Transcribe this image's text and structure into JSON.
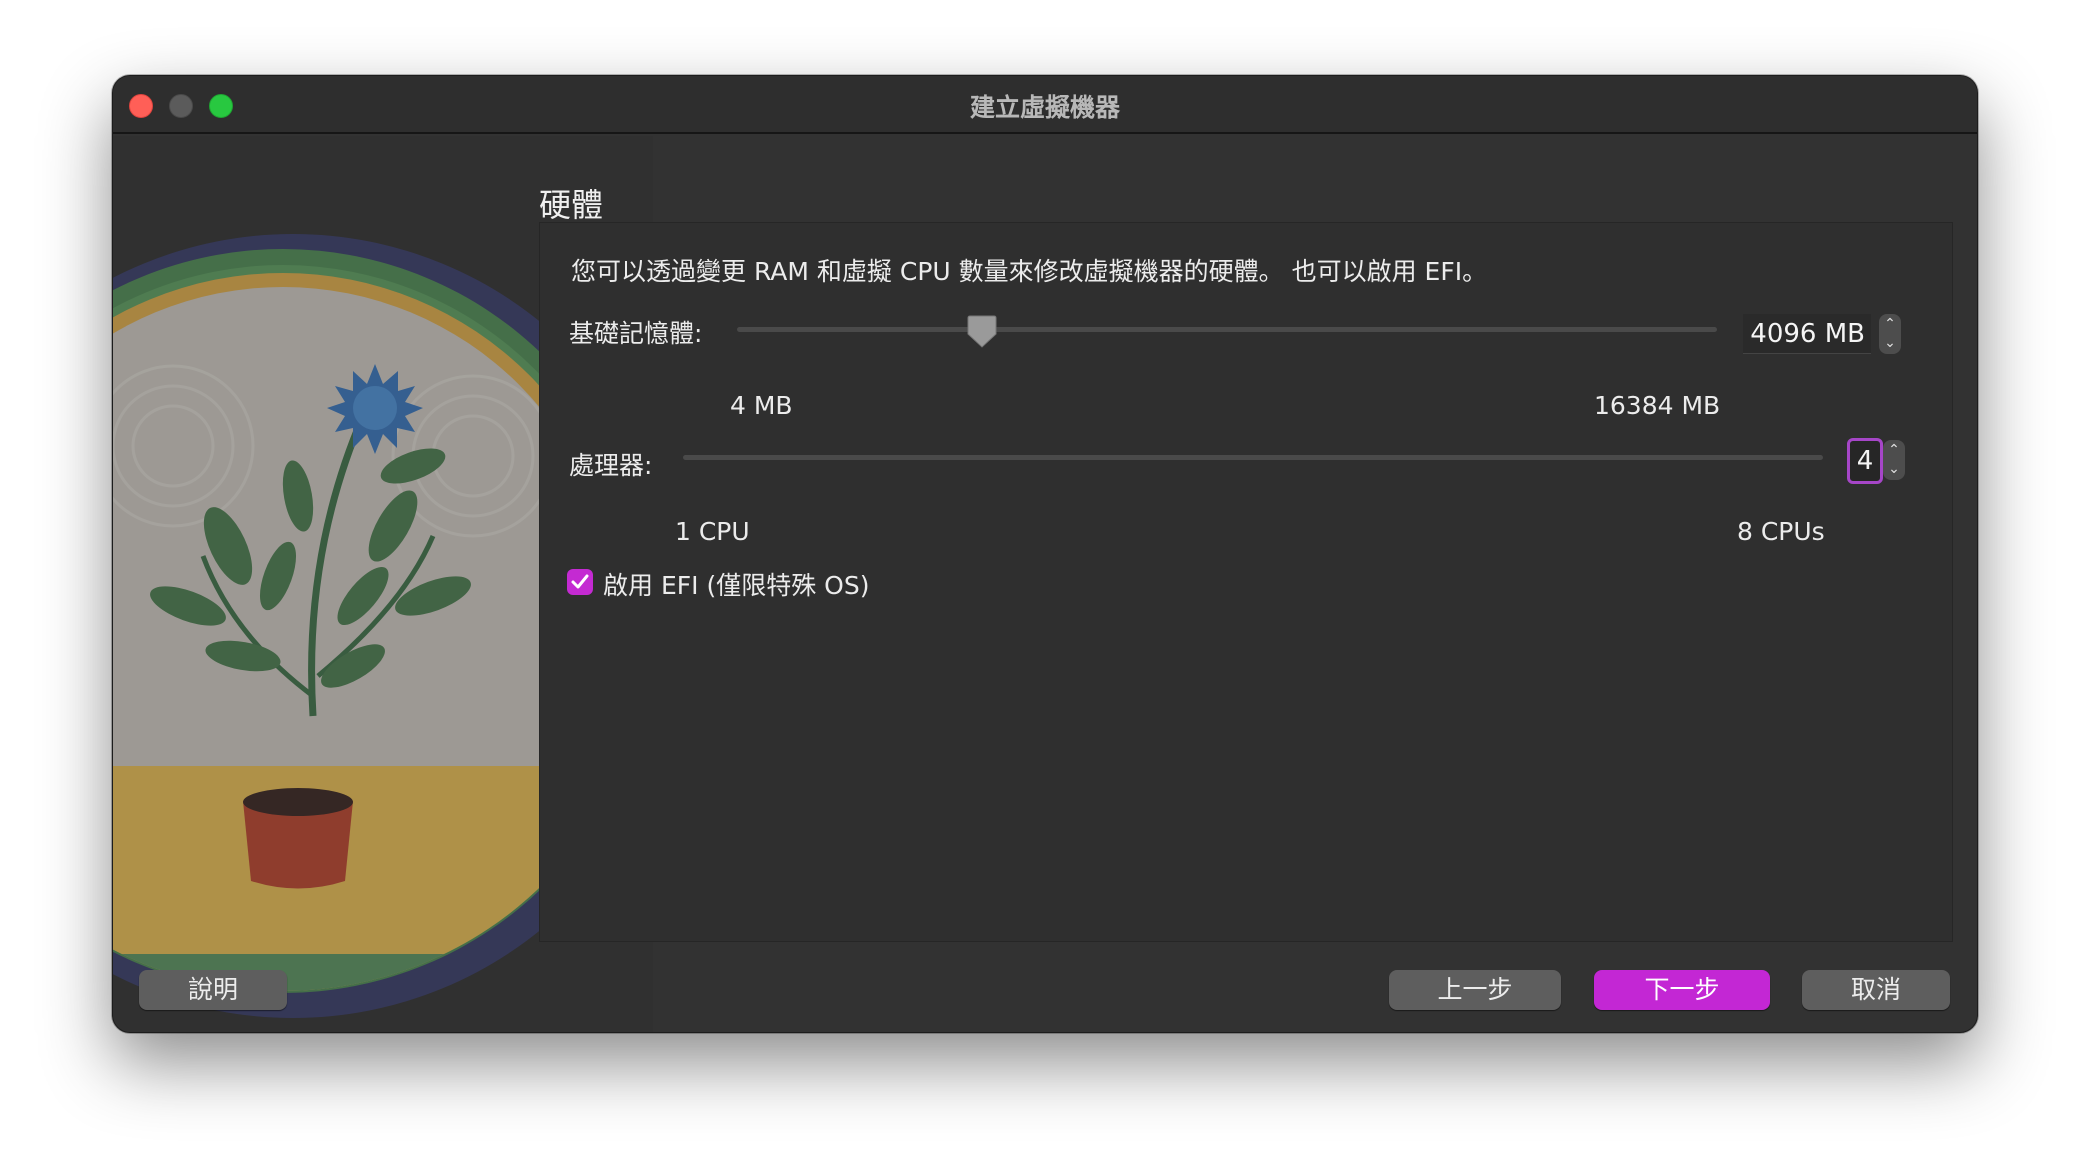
{
  "window": {
    "title": "建立虛擬機器"
  },
  "section": {
    "title": "硬體",
    "description": "您可以透過變更 RAM 和虛擬 CPU 數量來修改虛擬機器的硬體。 也可以啟用 EFI。"
  },
  "memory": {
    "label": "基礎記憶體:",
    "value": "4096 MB",
    "value_fraction": 0.25,
    "min_label": "4 MB",
    "max_label": "16384 MB"
  },
  "processor": {
    "label": "處理器:",
    "value": "4",
    "value_fraction": 1.0,
    "min_label": "1 CPU",
    "max_label": "8 CPUs"
  },
  "efi": {
    "label": "啟用 EFI (僅限特殊 OS)",
    "checked": true
  },
  "buttons": {
    "help": "說明",
    "back": "上一步",
    "next": "下一步",
    "cancel": "取消"
  },
  "colors": {
    "accent": "#c327d4",
    "window_bg": "#323232",
    "close": "#ff5f57",
    "minimize": "#5b5b5b",
    "maximize": "#28c840"
  },
  "icons": {
    "close": "close-dot-icon",
    "minimize": "minimize-dot-icon",
    "maximize": "maximize-dot-icon",
    "stepper": "stepper-icon",
    "checkmark": "checkmark-icon",
    "illustration": "flower-pot-illustration"
  }
}
